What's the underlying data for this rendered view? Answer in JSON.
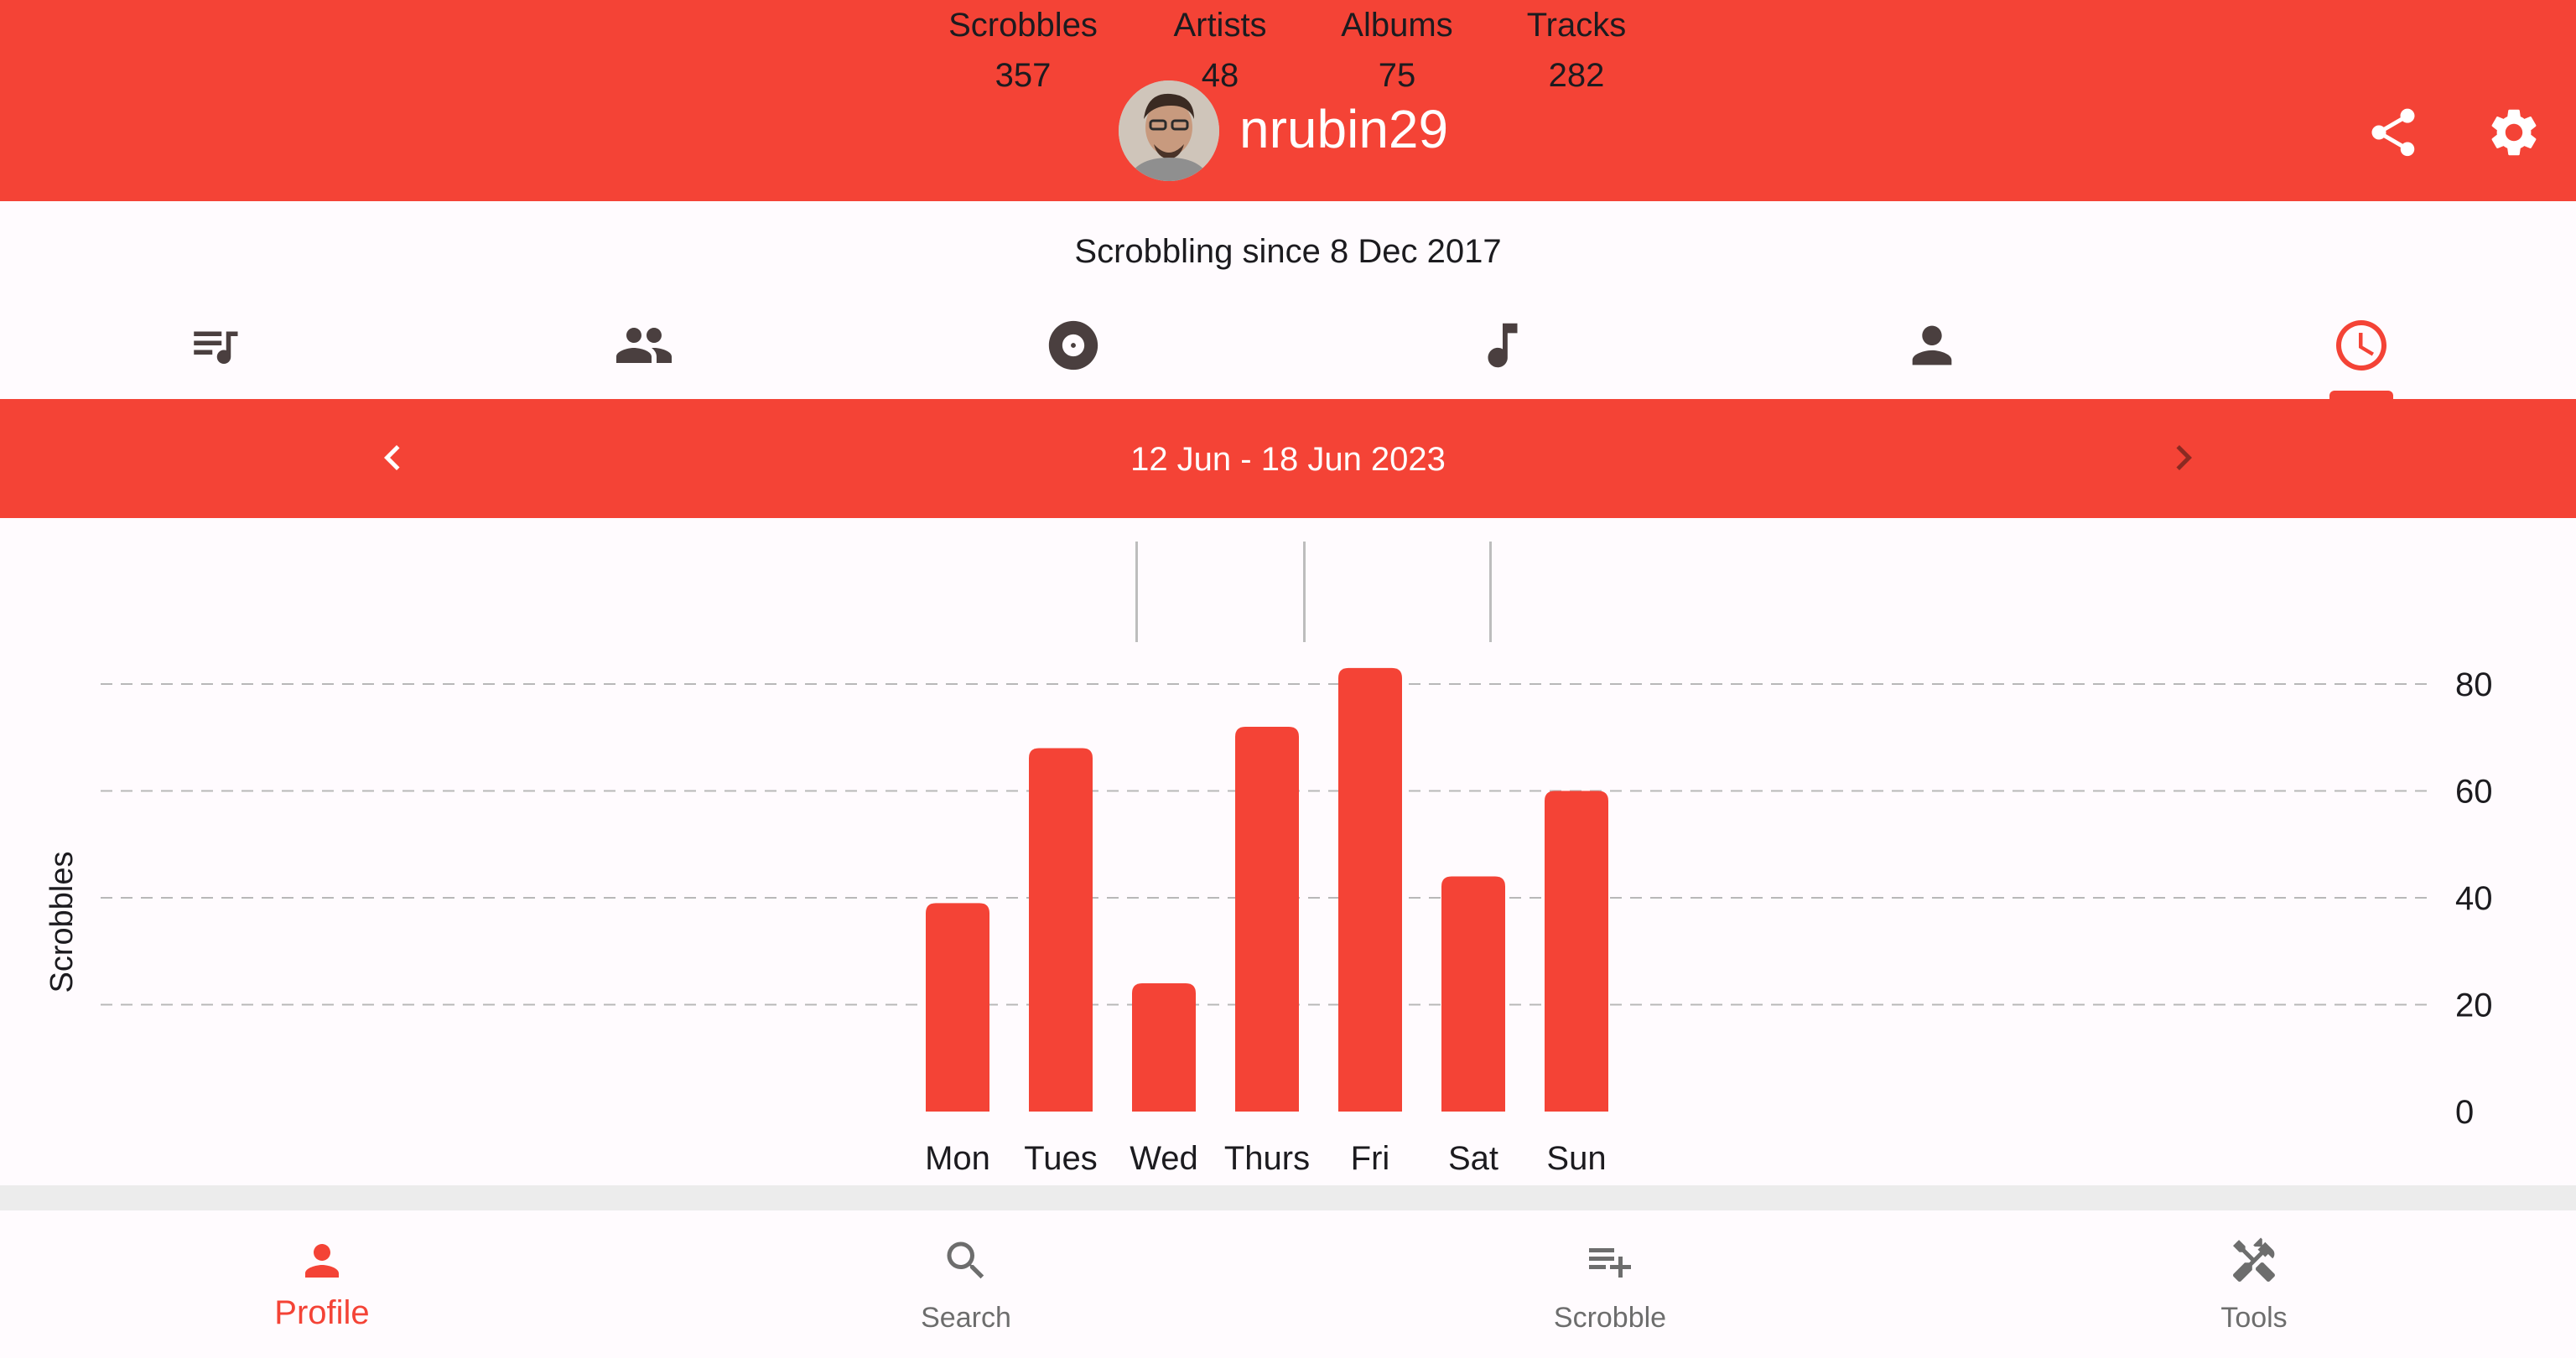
{
  "header": {
    "username": "nrubin29",
    "share_icon": "share-icon",
    "settings_icon": "gear-icon",
    "brand_color": "#f44336"
  },
  "profile": {
    "since_text": "Scrobbling since 8 Dec 2017"
  },
  "tabs": [
    {
      "icon": "playlist-music-icon",
      "selected": false
    },
    {
      "icon": "people-icon",
      "selected": false
    },
    {
      "icon": "album-icon",
      "selected": false
    },
    {
      "icon": "music-note-icon",
      "selected": false
    },
    {
      "icon": "person-icon",
      "selected": false
    },
    {
      "icon": "clock-icon",
      "selected": true
    }
  ],
  "date_range": {
    "label": "12 Jun - 18 Jun 2023",
    "prev_icon": "chevron-left-icon",
    "next_icon": "chevron-right-icon"
  },
  "stats": [
    {
      "label": "Scrobbles",
      "value": "357"
    },
    {
      "label": "Artists",
      "value": "48"
    },
    {
      "label": "Albums",
      "value": "75"
    },
    {
      "label": "Tracks",
      "value": "282"
    }
  ],
  "chart_data": {
    "type": "bar",
    "categories": [
      "Mon",
      "Tues",
      "Wed",
      "Thurs",
      "Fri",
      "Sat",
      "Sun"
    ],
    "values": [
      39,
      68,
      24,
      72,
      83,
      44,
      60
    ],
    "ylabel": "Scrobbles",
    "xlabel": "",
    "ylim": [
      0,
      80
    ],
    "yticks": [
      "0",
      "20",
      "40",
      "60",
      "80"
    ],
    "grid": true,
    "grid_style": "dashed",
    "bar_color": "#f44336"
  },
  "bottom_nav": [
    {
      "label": "Profile",
      "icon": "person-icon",
      "active": true
    },
    {
      "label": "Search",
      "icon": "search-icon",
      "active": false
    },
    {
      "label": "Scrobble",
      "icon": "playlist-add-icon",
      "active": false
    },
    {
      "label": "Tools",
      "icon": "tools-icon",
      "active": false
    }
  ]
}
